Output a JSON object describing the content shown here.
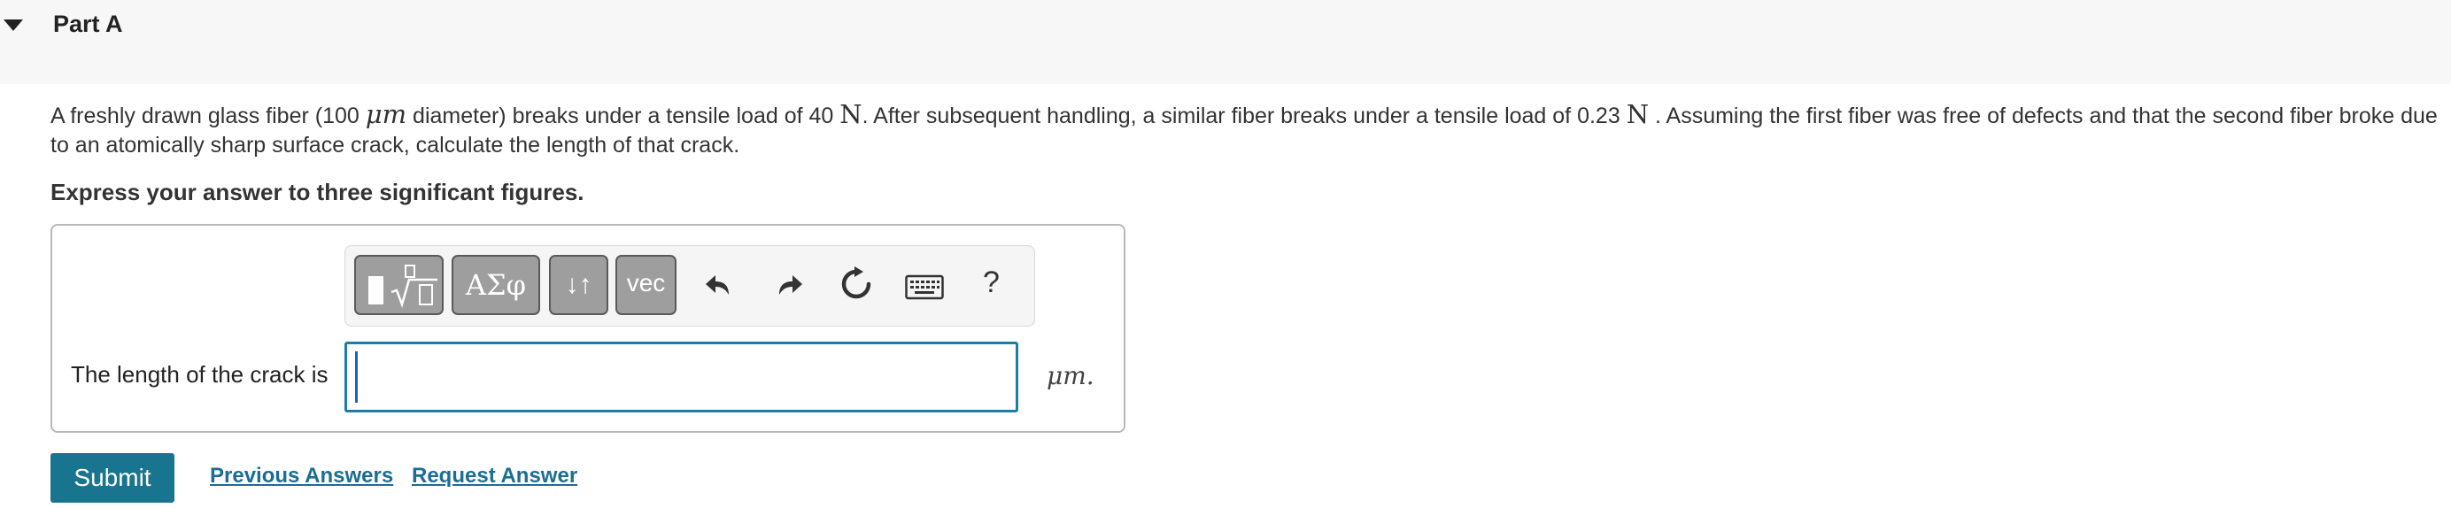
{
  "part": {
    "title": "Part A",
    "collapse_icon": "caret-down-icon"
  },
  "question": {
    "seg1": "A freshly drawn glass fiber (100 ",
    "unit_um": "μm",
    "seg2": " diameter) breaks under a tensile load of 40 ",
    "unit_n1": "N",
    "seg3": ". After subsequent handling, a similar fiber breaks under a tensile load of 0.23 ",
    "unit_n2": "N",
    "seg4": " . Assuming the first fiber was free of defects and that the second fiber broke due to an atomically sharp surface crack, calculate the length of that crack."
  },
  "instruction": "Express your answer to three significant figures.",
  "toolbar": {
    "templates_icon": "fraction-sqrt-template-icon",
    "greek_label": "ΑΣφ",
    "subscript_label": "↓↑",
    "vec_label": "vec",
    "undo_icon": "undo-icon",
    "redo_icon": "redo-icon",
    "reset_icon": "reset-icon",
    "keyboard_icon": "keyboard-icon",
    "help_label": "?"
  },
  "answer": {
    "label": "The length of the crack is",
    "value": "",
    "unit": "μm."
  },
  "actions": {
    "submit_label": "Submit",
    "previous_answers_label": "Previous Answers",
    "request_answer_label": "Request Answer"
  },
  "colors": {
    "accent": "#19758f",
    "link": "#1b6d96",
    "input_border": "#1a7ea6"
  }
}
